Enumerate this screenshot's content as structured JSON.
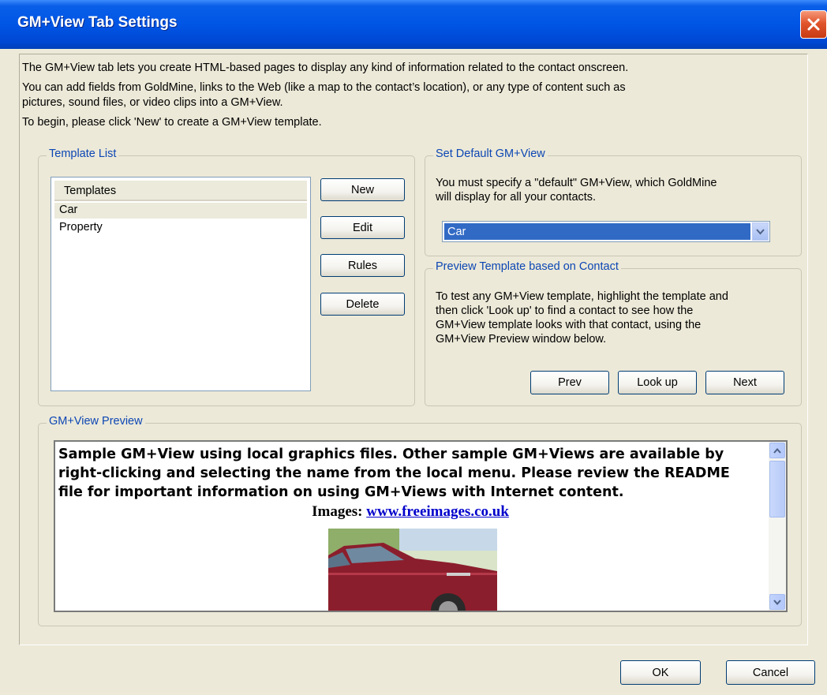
{
  "window": {
    "title": "GM+View Tab Settings"
  },
  "intro": {
    "line1": "The GM+View tab lets you  create HTML-based pages to display any kind of information related to the contact onscreen.",
    "line2a": "You can add fields from GoldMine, links to the Web (like a map to the contact’s location), or any type of content such as",
    "line2b": "pictures, sound files, or video clips into a GM+View.",
    "line3": "To begin, please click 'New' to create a GM+View template."
  },
  "template_list": {
    "legend": "Template List",
    "column_header": "Templates",
    "items": [
      "Car",
      "Property"
    ],
    "buttons": {
      "new": "New",
      "edit": "Edit",
      "rules": "Rules",
      "delete": "Delete"
    }
  },
  "set_default": {
    "legend": "Set Default GM+View",
    "desc1": "You must specify a \"default\" GM+View, which GoldMine",
    "desc2": "will display for all your contacts.",
    "selected": "Car"
  },
  "preview_template": {
    "legend": "Preview Template based on Contact",
    "desc1": "To test any GM+View template, highlight the template and",
    "desc2": "then click 'Look up' to find a contact to see how the",
    "desc3": "GM+View template looks with that contact, using the",
    "desc4": "GM+View Preview window below.",
    "buttons": {
      "prev": "Prev",
      "lookup": "Look up",
      "next": "Next"
    }
  },
  "gm_preview": {
    "legend": "GM+View Preview",
    "text1": "Sample GM+View using local graphics files. Other sample GM+Views are available by",
    "text2": "right-clicking and selecting the name from the local menu. Please review the README",
    "text3": "file for important information on using GM+Views with Internet content.",
    "images_label": "Images:",
    "images_link": "www.freeimages.co.uk"
  },
  "footer": {
    "ok": "OK",
    "cancel": "Cancel"
  },
  "colors": {
    "title_bar": "#0055e5",
    "legend_text": "#0c46b4",
    "selection": "#316ac5",
    "link": "#0000cc"
  }
}
